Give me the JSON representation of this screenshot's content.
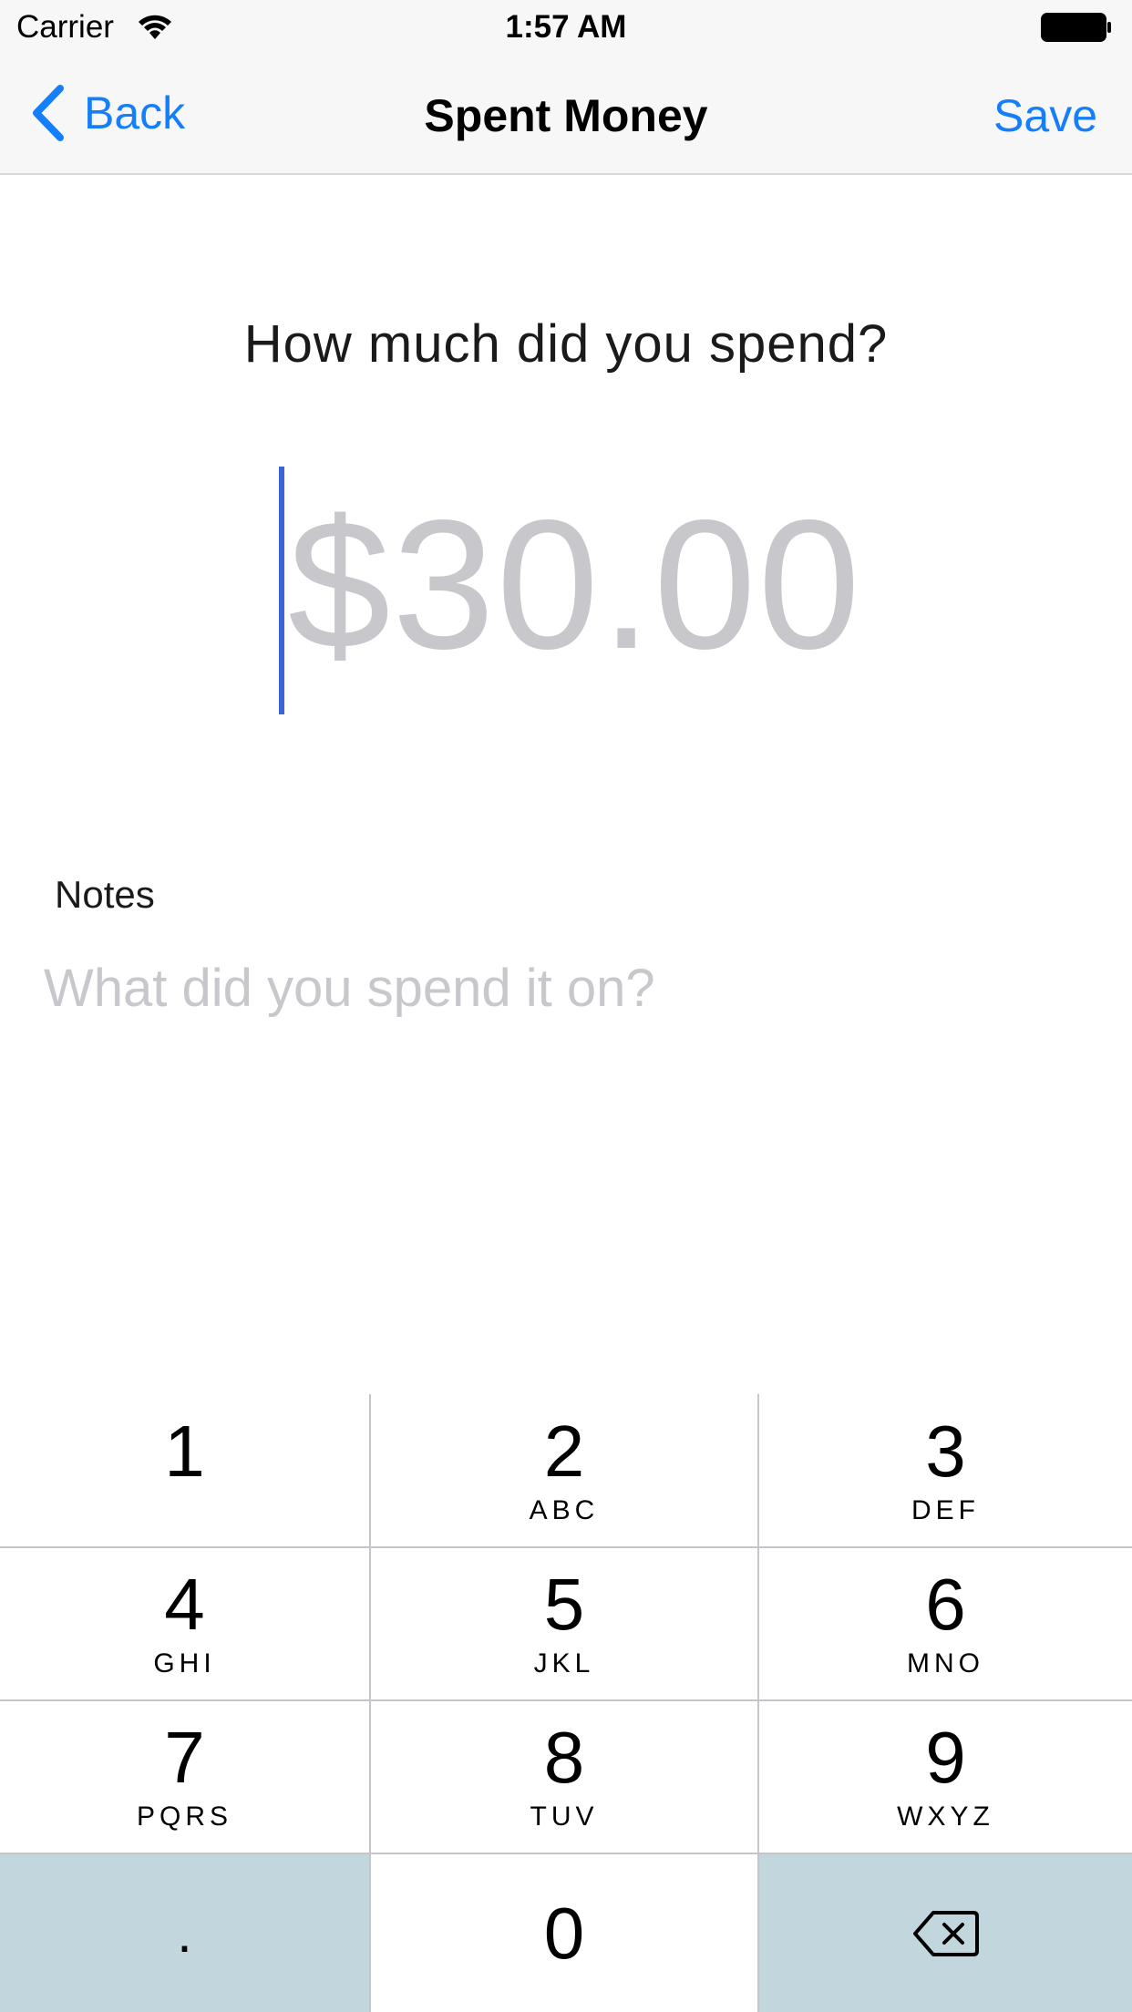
{
  "status_bar": {
    "carrier": "Carrier",
    "time": "1:57 AM"
  },
  "nav": {
    "back_label": "Back",
    "title": "Spent Money",
    "save_label": "Save"
  },
  "form": {
    "question": "How much did you spend?",
    "amount_placeholder": "$30.00",
    "notes_label": "Notes",
    "notes_placeholder": "What did you spend it on?",
    "notes_value": ""
  },
  "keypad": {
    "keys": [
      {
        "digit": "1",
        "letters": ""
      },
      {
        "digit": "2",
        "letters": "ABC"
      },
      {
        "digit": "3",
        "letters": "DEF"
      },
      {
        "digit": "4",
        "letters": "GHI"
      },
      {
        "digit": "5",
        "letters": "JKL"
      },
      {
        "digit": "6",
        "letters": "MNO"
      },
      {
        "digit": "7",
        "letters": "PQRS"
      },
      {
        "digit": "8",
        "letters": "TUV"
      },
      {
        "digit": "9",
        "letters": "WXYZ"
      }
    ],
    "decimal": ".",
    "zero": "0",
    "delete_icon": "backspace-icon"
  },
  "colors": {
    "accent": "#157efb",
    "cursor": "#3a63d9",
    "placeholder": "#c7c7cc",
    "function_key": "#c2d6dd"
  }
}
